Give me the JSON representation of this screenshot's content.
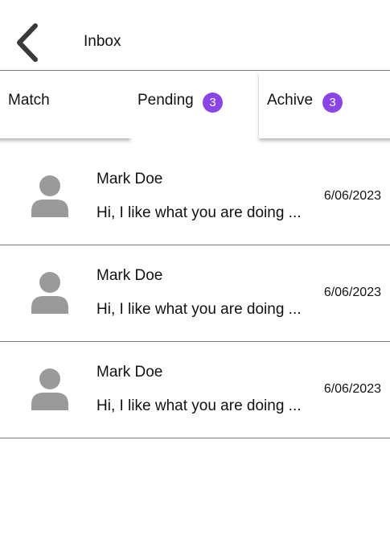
{
  "header": {
    "title": "Inbox",
    "back_icon": "chevron-left-icon"
  },
  "tabs": [
    {
      "label": "Match",
      "badge": null,
      "selected": false
    },
    {
      "label": "Pending",
      "badge": "3",
      "selected": true
    },
    {
      "label": "Achive",
      "badge": "3",
      "selected": false
    }
  ],
  "colors": {
    "badge": "#8b45e6",
    "avatar": "#9a9a9a",
    "divider": "#7a7a7a"
  },
  "messages": [
    {
      "name": "Mark Doe",
      "preview": "Hi, I like what you are doing ...",
      "date": "6/06/2023",
      "avatar_icon": "user-avatar-icon"
    },
    {
      "name": "Mark Doe",
      "preview": "Hi, I like what you are doing ...",
      "date": "6/06/2023",
      "avatar_icon": "user-avatar-icon"
    },
    {
      "name": "Mark Doe",
      "preview": "Hi, I like what you are doing ...",
      "date": "6/06/2023",
      "avatar_icon": "user-avatar-icon"
    }
  ]
}
